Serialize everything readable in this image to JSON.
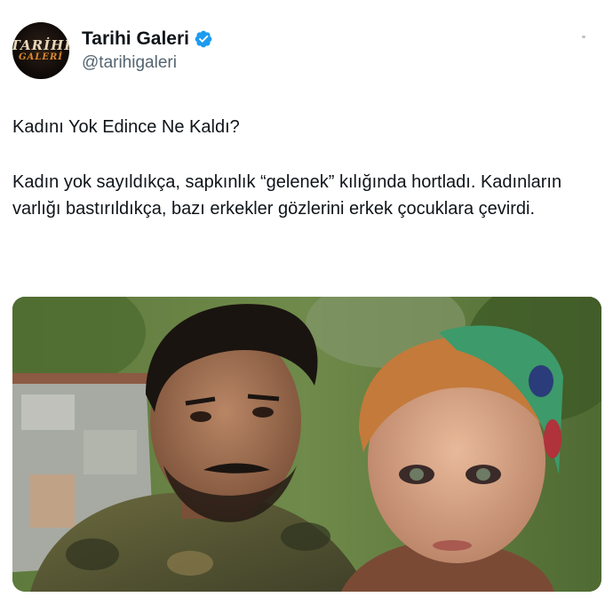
{
  "account": {
    "display_name": "Tarihi Galeri",
    "handle": "@tarihigaleri",
    "verified": true,
    "avatar_text_line1": "TARİHİ",
    "avatar_text_line2": "GALERİ"
  },
  "tweet": {
    "title": "Kadını Yok Edince Ne Kaldı?",
    "body": "Kadın yok sayıldıkça, sapkınlık “gelenek” kılığında hortladı. Kadınların varlığı bastırıldıkça, bazı erkekler gözlerini erkek çocuklara çevirdi."
  },
  "icons": {
    "verified": "verified-badge-icon"
  },
  "colors": {
    "text_primary": "#0f1419",
    "text_secondary": "#536471",
    "verified_blue": "#1d9bf0"
  }
}
